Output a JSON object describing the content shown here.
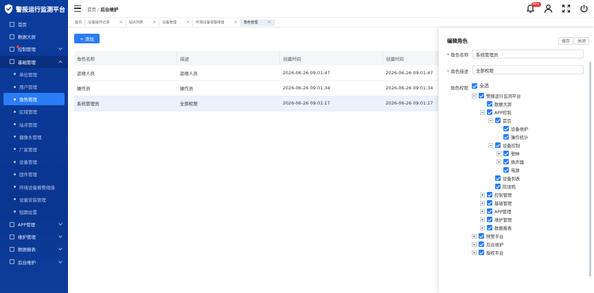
{
  "app": {
    "title": "警报运行监测平台"
  },
  "sidebar": {
    "items": [
      {
        "label": "首页",
        "type": "parent"
      },
      {
        "label": "数据大屏",
        "type": "parent"
      },
      {
        "label": "控制管理",
        "type": "parent",
        "chevron": true,
        "dot": true
      },
      {
        "label": "基础管理",
        "type": "parent",
        "chevron": true,
        "open": true
      },
      {
        "label": "单位管理",
        "type": "sub"
      },
      {
        "label": "用户管理",
        "type": "sub"
      },
      {
        "label": "角色管理",
        "type": "sub",
        "active": true
      },
      {
        "label": "区域管理",
        "type": "sub"
      },
      {
        "label": "站点管理",
        "type": "sub"
      },
      {
        "label": "摄像头管理",
        "type": "sub"
      },
      {
        "label": "厂家管理",
        "type": "sub"
      },
      {
        "label": "设备管理",
        "type": "sub"
      },
      {
        "label": "固件管理",
        "type": "sub"
      },
      {
        "label": "环境设备报警阈值",
        "type": "sub"
      },
      {
        "label": "设备安装管理",
        "type": "sub"
      },
      {
        "label": "短期设置",
        "type": "sub"
      },
      {
        "label": "APP管理",
        "type": "parent",
        "chevron": true
      },
      {
        "label": "维护管理",
        "type": "parent",
        "chevron": true
      },
      {
        "label": "数据报表",
        "type": "parent",
        "chevron": true
      },
      {
        "label": "后台维护",
        "type": "parent",
        "chevron": true
      }
    ]
  },
  "header": {
    "breadcrumb_home": "首页",
    "breadcrumb_sep": " / ",
    "breadcrumb_current": "后台维护",
    "bell_badge": "99+"
  },
  "tabs": [
    {
      "label": "首页",
      "closable": false
    },
    {
      "label": "设备操作记录",
      "closable": true
    },
    {
      "label": "站点列表",
      "closable": true
    },
    {
      "label": "设备管理",
      "closable": true
    },
    {
      "label": "环境设备报警阈值",
      "closable": true
    },
    {
      "label": "角色管理",
      "closable": true,
      "current": true
    }
  ],
  "toolbar": {
    "add_label": "+ 添加"
  },
  "table": {
    "headers": [
      "角色名称",
      "描述",
      "创建时间",
      "创建时间"
    ],
    "rows": [
      [
        "运维人员",
        "运维人员",
        "2026-06-26 09:01:47",
        "2026-06-26 09:01:47"
      ],
      [
        "操作员",
        "操作员",
        "2026-06-26 09:01:34",
        "2026-06-26 09:01:34"
      ],
      [
        "系统管理员",
        "全部权限",
        "2026-06-26 09:01:17",
        "2026-06-26 09:01:17"
      ]
    ],
    "selected_row": 2
  },
  "panel": {
    "title": "编辑角色",
    "save_label": "保存",
    "close_label": "关闭",
    "name_label": "角色名称",
    "name_value": "系统管理员",
    "desc_label": "角色描述",
    "desc_value": "全部权限",
    "perm_label": "角色权限",
    "select_all": "全选",
    "tree": [
      {
        "label": "警报运行监测平台",
        "level": 0,
        "expander": "minus"
      },
      {
        "label": "数据大屏",
        "level": 1,
        "expander": "none"
      },
      {
        "label": "APP控制",
        "level": 1,
        "expander": "minus"
      },
      {
        "label": "首页",
        "level": 2,
        "expander": "minus"
      },
      {
        "label": "设备维护",
        "level": 3,
        "expander": "none"
      },
      {
        "label": "操作统计",
        "level": 3,
        "expander": "none"
      },
      {
        "label": "设备控制",
        "level": 2,
        "expander": "minus"
      },
      {
        "label": "警种",
        "level": 3,
        "expander": "plus"
      },
      {
        "label": "扬声器",
        "level": 3,
        "expander": "plus"
      },
      {
        "label": "电源",
        "level": 3,
        "expander": "none"
      },
      {
        "label": "设备列表",
        "level": 2,
        "expander": "none"
      },
      {
        "label": "防误鸣",
        "level": 2,
        "expander": "none"
      },
      {
        "label": "控制管理",
        "level": 1,
        "expander": "plus"
      },
      {
        "label": "基础管理",
        "level": 1,
        "expander": "plus"
      },
      {
        "label": "APP管理",
        "level": 1,
        "expander": "plus"
      },
      {
        "label": "维护管理",
        "level": 1,
        "expander": "plus"
      },
      {
        "label": "数据报表",
        "level": 1,
        "expander": "plus"
      },
      {
        "label": "预警平台",
        "level": 0,
        "expander": "plus"
      },
      {
        "label": "后台维护",
        "level": 0,
        "expander": "plus"
      },
      {
        "label": "授权平台",
        "level": 0,
        "expander": "plus"
      }
    ]
  },
  "colors": {
    "sidebar": "#0b3d9e",
    "accent": "#2a7df4",
    "danger": "#e63c3c"
  }
}
